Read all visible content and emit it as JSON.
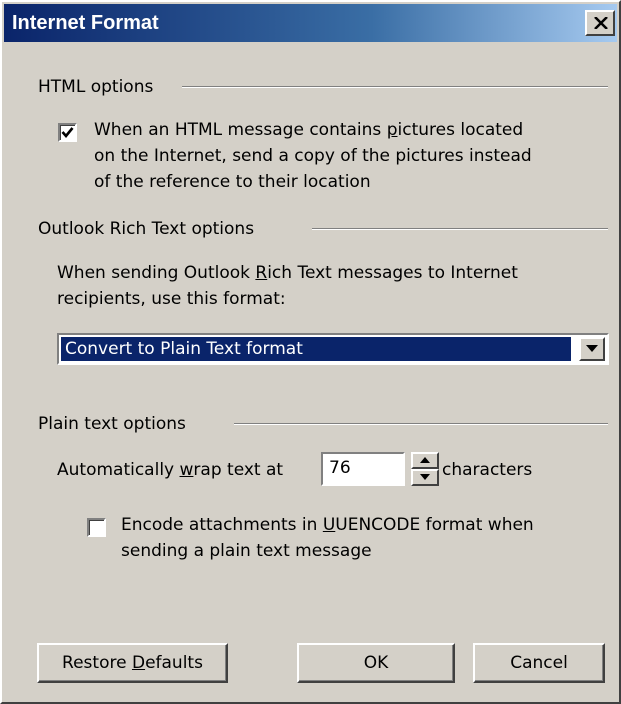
{
  "window": {
    "title": "Internet Format"
  },
  "html_options": {
    "header": "HTML options",
    "send_pictures": {
      "checked": true,
      "line1_pre": "When an HTML message contains ",
      "line1_mn": "p",
      "line1_post": "ictures located",
      "line2": "on the Internet, send a copy of the pictures instead",
      "line3": "of the reference to their location"
    }
  },
  "rich_text_options": {
    "header": "Outlook Rich Text options",
    "desc_line1_pre": "When sending Outlook ",
    "desc_line1_mn": "R",
    "desc_line1_post": "ich Text messages to Internet",
    "desc_line2": "recipients, use this format:",
    "format_selected": "Convert to Plain Text format"
  },
  "plain_text_options": {
    "header": "Plain text options",
    "wrap_pre": "Automatically ",
    "wrap_mn": "w",
    "wrap_post": "rap text at",
    "wrap_value": "76",
    "wrap_units": "characters",
    "uuencode": {
      "checked": false,
      "line1_pre": "Encode attachments in ",
      "line1_mn": "U",
      "line1_post": "UENCODE format when",
      "line2": "sending a plain text message"
    }
  },
  "buttons": {
    "restore_pre": "Restore ",
    "restore_mn": "D",
    "restore_post": "efaults",
    "ok": "OK",
    "cancel": "Cancel"
  }
}
